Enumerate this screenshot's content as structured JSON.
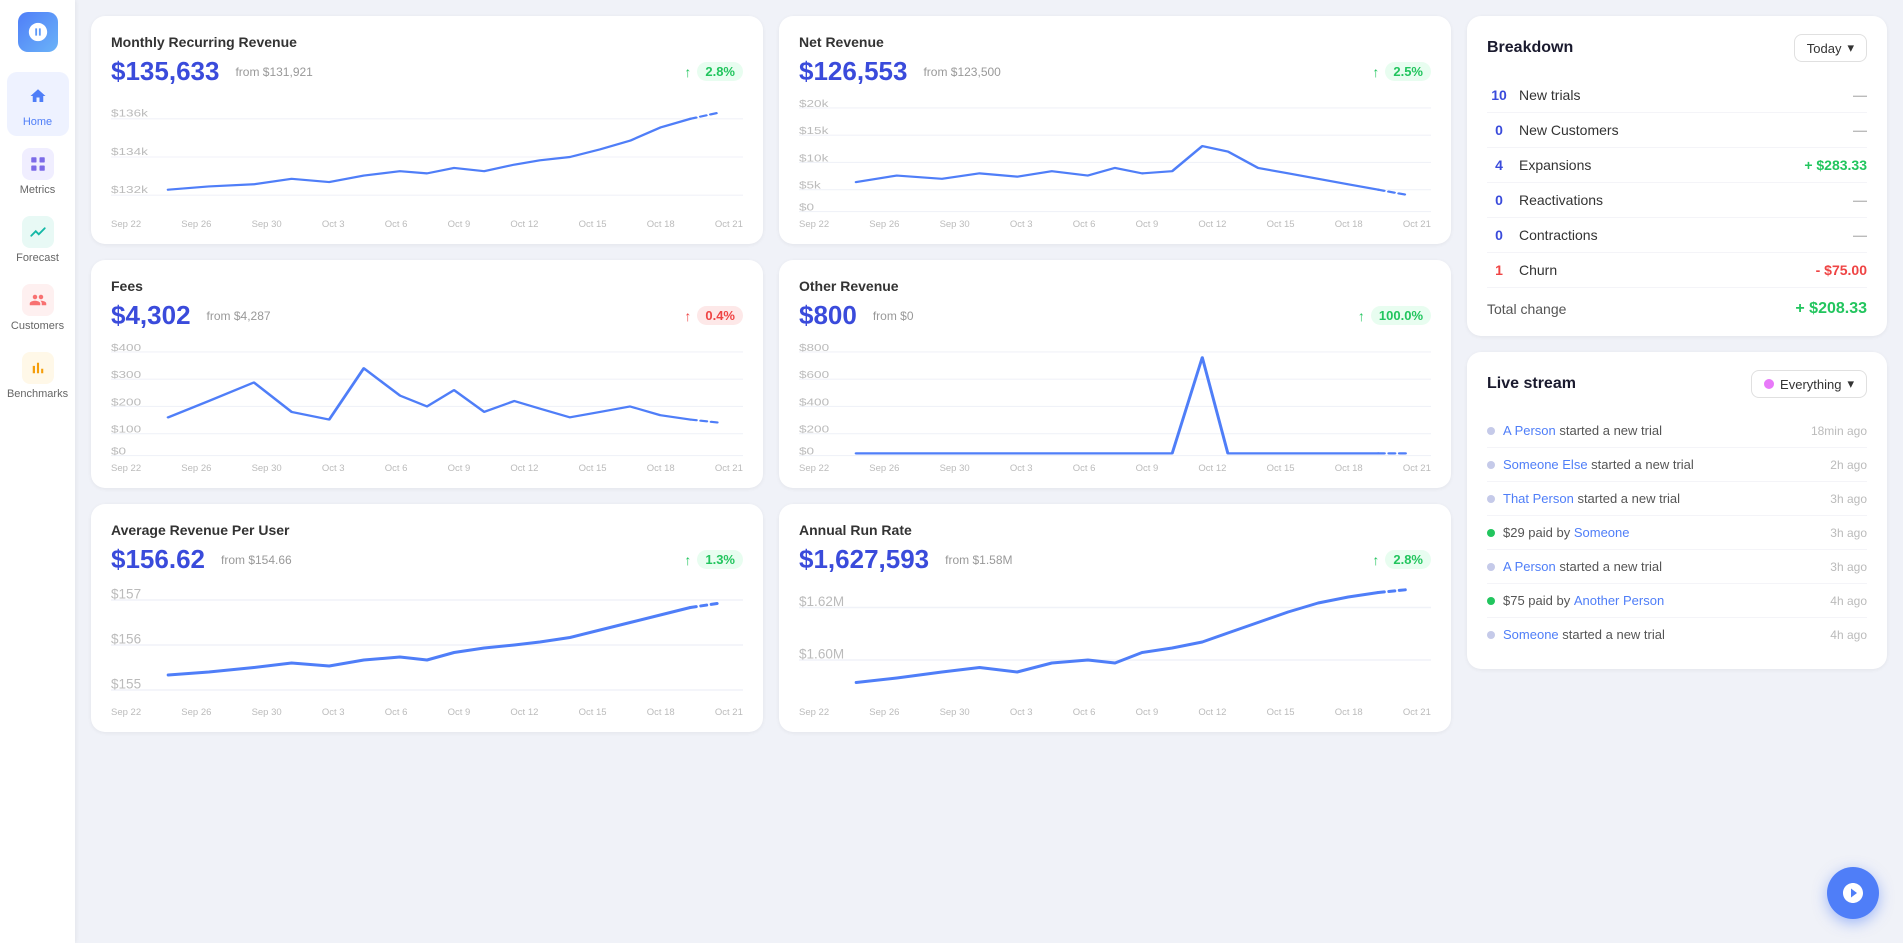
{
  "sidebar": {
    "logo_title": "App Logo",
    "items": [
      {
        "id": "home",
        "label": "Home",
        "active": true
      },
      {
        "id": "metrics",
        "label": "Metrics",
        "active": false
      },
      {
        "id": "forecast",
        "label": "Forecast",
        "active": false
      },
      {
        "id": "customers",
        "label": "Customers",
        "active": false
      },
      {
        "id": "benchmarks",
        "label": "Benchmarks",
        "active": false
      }
    ]
  },
  "charts": [
    {
      "id": "mrr",
      "title": "Monthly Recurring Revenue",
      "value": "$135,633",
      "from": "from $131,921",
      "badge": "2.8%",
      "badge_type": "green",
      "x_labels": [
        "Sep 22",
        "Sep 26",
        "Sep 30",
        "Oct 3",
        "Oct 6",
        "Oct 9",
        "Oct 12",
        "Oct 15",
        "Oct 18",
        "Oct 21"
      ],
      "y_labels": [
        "$136k",
        "$134k",
        "$132k"
      ]
    },
    {
      "id": "net_revenue",
      "title": "Net Revenue",
      "value": "$126,553",
      "from": "from $123,500",
      "badge": "2.5%",
      "badge_type": "green",
      "x_labels": [
        "Sep 22",
        "Sep 26",
        "Sep 30",
        "Oct 3",
        "Oct 6",
        "Oct 9",
        "Oct 12",
        "Oct 15",
        "Oct 18",
        "Oct 21"
      ],
      "y_labels": [
        "$20k",
        "$15k",
        "$10k",
        "$5k",
        "$0"
      ]
    },
    {
      "id": "fees",
      "title": "Fees",
      "value": "$4,302",
      "from": "from $4,287",
      "badge": "0.4%",
      "badge_type": "red",
      "x_labels": [
        "Sep 22",
        "Sep 26",
        "Sep 30",
        "Oct 3",
        "Oct 6",
        "Oct 9",
        "Oct 12",
        "Oct 15",
        "Oct 18",
        "Oct 21"
      ],
      "y_labels": [
        "$400",
        "$300",
        "$200",
        "$100",
        "$0"
      ]
    },
    {
      "id": "other_revenue",
      "title": "Other Revenue",
      "value": "$800",
      "from": "from $0",
      "badge": "100.0%",
      "badge_type": "green",
      "x_labels": [
        "Sep 22",
        "Sep 26",
        "Sep 30",
        "Oct 3",
        "Oct 6",
        "Oct 9",
        "Oct 12",
        "Oct 15",
        "Oct 18",
        "Oct 21"
      ],
      "y_labels": [
        "$800",
        "$600",
        "$400",
        "$200",
        "$0"
      ]
    },
    {
      "id": "arpu",
      "title": "Average Revenue Per User",
      "value": "$156.62",
      "from": "from $154.66",
      "badge": "1.3%",
      "badge_type": "green",
      "x_labels": [
        "Sep 22",
        "Sep 26",
        "Sep 30",
        "Oct 3",
        "Oct 6",
        "Oct 9",
        "Oct 12",
        "Oct 15",
        "Oct 18",
        "Oct 21"
      ],
      "y_labels": [
        "$157",
        "$156",
        "$155"
      ]
    },
    {
      "id": "arr",
      "title": "Annual Run Rate",
      "value": "$1,627,593",
      "from": "from $1.58M",
      "badge": "2.8%",
      "badge_type": "green",
      "x_labels": [
        "Sep 22",
        "Sep 26",
        "Sep 30",
        "Oct 3",
        "Oct 6",
        "Oct 9",
        "Oct 12",
        "Oct 15",
        "Oct 18",
        "Oct 21"
      ],
      "y_labels": [
        "$1.62M",
        "$1.60M"
      ]
    }
  ],
  "breakdown": {
    "title": "Breakdown",
    "dropdown_label": "Today",
    "rows": [
      {
        "num": "10",
        "label": "New trials",
        "value": "—",
        "type": "dash"
      },
      {
        "num": "0",
        "label": "New Customers",
        "value": "—",
        "type": "dash"
      },
      {
        "num": "4",
        "label": "Expansions",
        "value": "+ $283.33",
        "type": "green"
      },
      {
        "num": "0",
        "label": "Reactivations",
        "value": "—",
        "type": "dash"
      },
      {
        "num": "0",
        "label": "Contractions",
        "value": "—",
        "type": "dash"
      },
      {
        "num": "1",
        "label": "Churn",
        "value": "- $75.00",
        "type": "red"
      }
    ],
    "total_label": "Total change",
    "total_value": "+ $208.33"
  },
  "livestream": {
    "title": "Live stream",
    "dropdown_label": "Everything",
    "items": [
      {
        "dot": "gray",
        "text_pre": "",
        "link": "A Person",
        "text_post": " started a new trial",
        "time": "18min ago"
      },
      {
        "dot": "gray",
        "text_pre": "",
        "link": "Someone Else",
        "text_post": " started a new trial",
        "time": "2h ago"
      },
      {
        "dot": "gray",
        "text_pre": "",
        "link": "That Person",
        "text_post": " started a new trial",
        "time": "3h ago"
      },
      {
        "dot": "green",
        "text_pre": "$29 paid by ",
        "link": "Someone",
        "text_post": "",
        "time": "3h ago"
      },
      {
        "dot": "gray",
        "text_pre": "",
        "link": "A Person",
        "text_post": " started a new trial",
        "time": "3h ago"
      },
      {
        "dot": "green",
        "text_pre": "$75 paid by ",
        "link": "Another Person",
        "text_post": "",
        "time": "4h ago"
      },
      {
        "dot": "gray",
        "text_pre": "",
        "link": "Someone",
        "text_post": " started a new trial",
        "time": "4h ago"
      }
    ]
  }
}
